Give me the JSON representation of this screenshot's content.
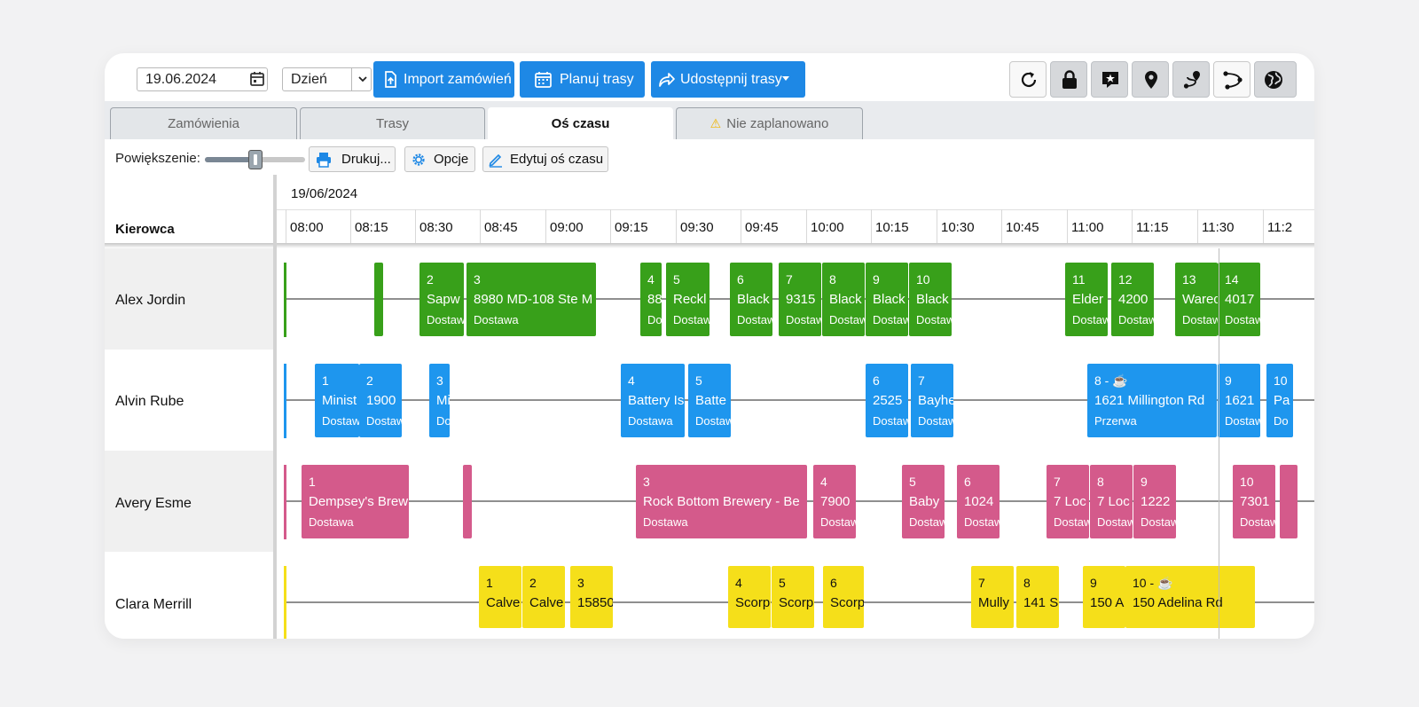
{
  "toolbar": {
    "date_value": "19.06.2024",
    "view_value": "Dzień",
    "import_label": "Import zamówień",
    "plan_label": "Planuj trasy",
    "share_label": "Udostępnij trasy",
    "icons": [
      "refresh-icon",
      "lock-icon",
      "star-comment-icon",
      "map-pin-icon",
      "route-pin-icon",
      "route-icon",
      "globe-icon"
    ]
  },
  "tabs": [
    "Zamówienia",
    "Trasy",
    "Oś czasu",
    "Nie zaplanowano"
  ],
  "active_tab": "Oś czasu",
  "options": {
    "zoom_label": "Powiększenie:",
    "zoom_level": 0.5,
    "print_label": "Drukuj...",
    "options_label": "Opcje",
    "edit_label": "Edytuj oś czasu"
  },
  "timeline": {
    "driver_column_label": "Kierowca",
    "date": "19/06/2024",
    "ticks": [
      "08:00",
      "08:15",
      "08:30",
      "08:45",
      "09:00",
      "09:15",
      "09:30",
      "09:45",
      "10:00",
      "10:15",
      "10:30",
      "10:45",
      "11:00",
      "11:15",
      "11:30",
      "11:2"
    ]
  },
  "drivers": [
    {
      "name": "Alex Jordin",
      "color": "#38a01a",
      "stops": [
        {
          "n": "",
          "addr": "",
          "type": ""
        },
        {
          "n": "2",
          "addr": "Sapw",
          "type": "Dostawa"
        },
        {
          "n": "3",
          "addr": "8980 MD-108 Ste M",
          "type": "Dostawa"
        },
        {
          "n": "4",
          "addr": "88",
          "type": "Do"
        },
        {
          "n": "5",
          "addr": "Reckl",
          "type": "Dostawa"
        },
        {
          "n": "6",
          "addr": "Black",
          "type": "Dostawa"
        },
        {
          "n": "7",
          "addr": "9315",
          "type": "Dostawa"
        },
        {
          "n": "8",
          "addr": "Black",
          "type": "Dostawa"
        },
        {
          "n": "9",
          "addr": "Black",
          "type": "Dostawa"
        },
        {
          "n": "10",
          "addr": "Black",
          "type": "Dostawa"
        },
        {
          "n": "11",
          "addr": "Elder",
          "type": "Dostawa"
        },
        {
          "n": "12",
          "addr": "4200",
          "type": "Dostawa"
        },
        {
          "n": "13",
          "addr": "Warec",
          "type": "Dostawa"
        },
        {
          "n": "14",
          "addr": "4017",
          "type": "Dostawa"
        }
      ]
    },
    {
      "name": "Alvin Rube",
      "color": "#1e96ee",
      "stops": [
        {
          "n": "1",
          "addr": "Minist",
          "type": "Dostawa"
        },
        {
          "n": "2",
          "addr": "1900",
          "type": "Dostawa"
        },
        {
          "n": "3",
          "addr": "Mi",
          "type": "Do"
        },
        {
          "n": "4",
          "addr": "Battery Is",
          "type": "Dostawa"
        },
        {
          "n": "5",
          "addr": "Batte",
          "type": "Dostawa"
        },
        {
          "n": "6",
          "addr": "2525",
          "type": "Dostawa"
        },
        {
          "n": "7",
          "addr": "Bayhe",
          "type": "Dostawa"
        },
        {
          "n": "8 - ☕",
          "addr": "1621 Millington Rd",
          "type": "Przerwa"
        },
        {
          "n": "9",
          "addr": "1621",
          "type": "Dostawa"
        },
        {
          "n": "10",
          "addr": "Pa",
          "type": "Do"
        }
      ]
    },
    {
      "name": "Avery Esme",
      "color": "#d45a8b",
      "stops": [
        {
          "n": "1",
          "addr": "Dempsey's Brew",
          "type": "Dostawa"
        },
        {
          "n": "",
          "addr": "",
          "type": ""
        },
        {
          "n": "3",
          "addr": "Rock Bottom Brewery - Be",
          "type": "Dostawa"
        },
        {
          "n": "4",
          "addr": "7900",
          "type": "Dostawa"
        },
        {
          "n": "5",
          "addr": "Baby",
          "type": "Dostawa"
        },
        {
          "n": "6",
          "addr": "1024",
          "type": "Dostawa"
        },
        {
          "n": "7",
          "addr": "7 Loc",
          "type": "Dostawa"
        },
        {
          "n": "8",
          "addr": "7 Loc",
          "type": "Dostawa"
        },
        {
          "n": "9",
          "addr": "1222",
          "type": "Dostawa"
        },
        {
          "n": "10",
          "addr": "7301",
          "type": "Dostawa"
        },
        {
          "n": "",
          "addr": "",
          "type": ""
        }
      ]
    },
    {
      "name": "Clara Merrill",
      "color": "#f5df1a",
      "stops": [
        {
          "n": "1",
          "addr": "Calve",
          "type": ""
        },
        {
          "n": "2",
          "addr": "Calve",
          "type": ""
        },
        {
          "n": "3",
          "addr": "15850",
          "type": ""
        },
        {
          "n": "4",
          "addr": "Scorp",
          "type": ""
        },
        {
          "n": "5",
          "addr": "Scorp",
          "type": ""
        },
        {
          "n": "6",
          "addr": "Scorp",
          "type": ""
        },
        {
          "n": "7",
          "addr": "Mully",
          "type": ""
        },
        {
          "n": "8",
          "addr": "141 S",
          "type": ""
        },
        {
          "n": "9",
          "addr": "150 A",
          "type": ""
        },
        {
          "n": "10 - ☕",
          "addr": "150 Adelina Rd",
          "type": ""
        }
      ]
    }
  ]
}
